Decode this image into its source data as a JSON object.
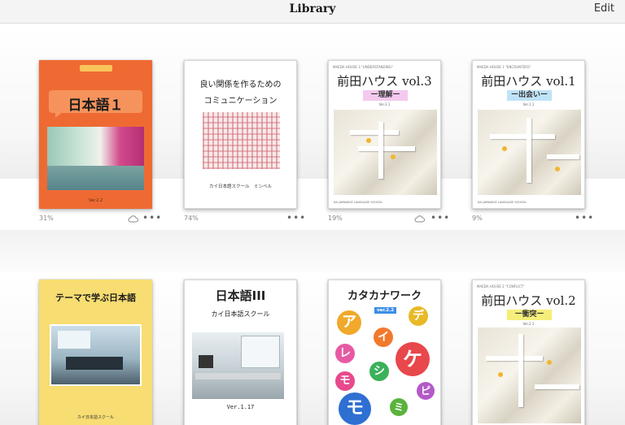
{
  "header": {
    "title": "Library",
    "edit_label": "Edit"
  },
  "icons": {
    "cloud": "cloud-icon",
    "more": "more-icon"
  },
  "books": [
    {
      "title": "日本語１",
      "version": "Ver.2.2",
      "progress": "31%"
    },
    {
      "title_line1": "良い関係を作るための",
      "title_line2": "コミュニケーション",
      "publisher": "カイ日本語スクール　ミンベル",
      "progress": "74%"
    },
    {
      "header": "MAEDA HOUSE 3 \"UNDERSTANDING\"",
      "title": "前田ハウス vol.3",
      "subtitle": "ー理解ー",
      "version": "Ver.3.1",
      "footer": "KAI JAPANESE LANGUAGE SCHOOL",
      "progress": "19%"
    },
    {
      "header": "MAEDA HOUSE 1 \"ENCOUNTERS\"",
      "title": "前田ハウス vol.1",
      "subtitle": "ー出会いー",
      "version": "Ver.1.1",
      "footer": "KAI JAPANESE LANGUAGE SCHOOL",
      "progress": "9%"
    },
    {
      "title": "テーマで学ぶ日本語",
      "publisher": "カイ日本語スクール"
    },
    {
      "title": "日本語III",
      "publisher": "カイ日本語スクール",
      "version": "Ver.1.17"
    },
    {
      "title": "カタカナワーク",
      "version": "ver.2.2",
      "chars": [
        "ア",
        "イ",
        "デ",
        "レ",
        "シ",
        "ケ",
        "モ",
        "ミ",
        "ピ"
      ]
    },
    {
      "header": "MAEDA HOUSE 2 \"CONFLICT\"",
      "title": "前田ハウス vol.2",
      "subtitle": "ー衝突ー",
      "version": "Ver.2.1"
    }
  ]
}
